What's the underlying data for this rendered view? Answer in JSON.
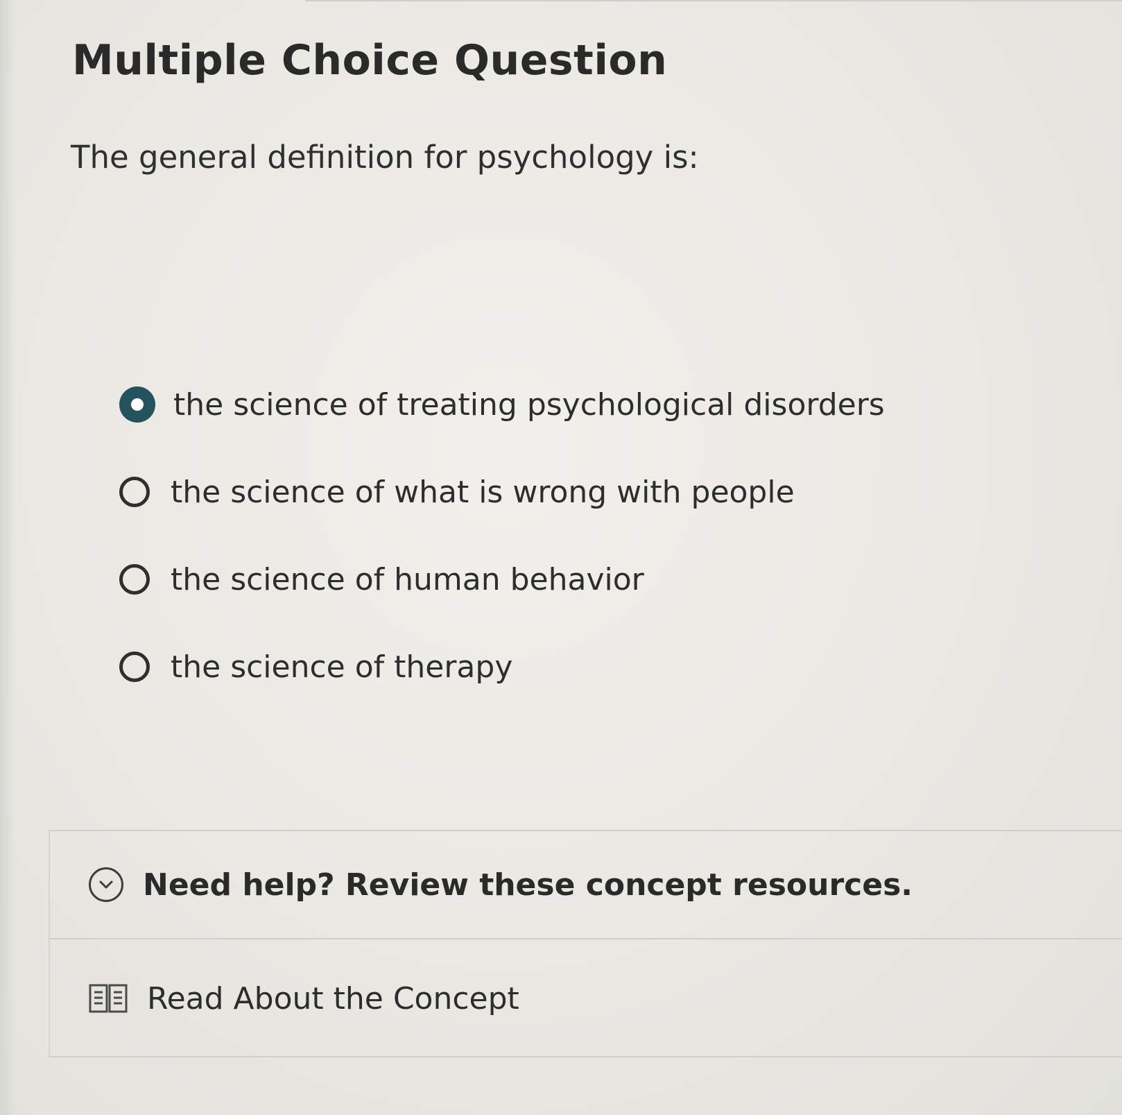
{
  "question": {
    "title": "Multiple Choice Question",
    "prompt": "The general definition for psychology is:"
  },
  "options": [
    {
      "label": "the science of treating psychological disorders",
      "selected": true
    },
    {
      "label": "the science of what is wrong with people",
      "selected": false
    },
    {
      "label": "the science of human behavior",
      "selected": false
    },
    {
      "label": "the science of therapy",
      "selected": false
    }
  ],
  "help": {
    "header": "Need help? Review these concept resources.",
    "header_icon": "chevron-down-circle-icon",
    "resources": [
      {
        "label": "Read About the Concept",
        "icon": "book-icon"
      }
    ]
  },
  "colors": {
    "selected_radio": "#23545e",
    "text": "#2d2d2d",
    "background": "#ebe9e4"
  }
}
